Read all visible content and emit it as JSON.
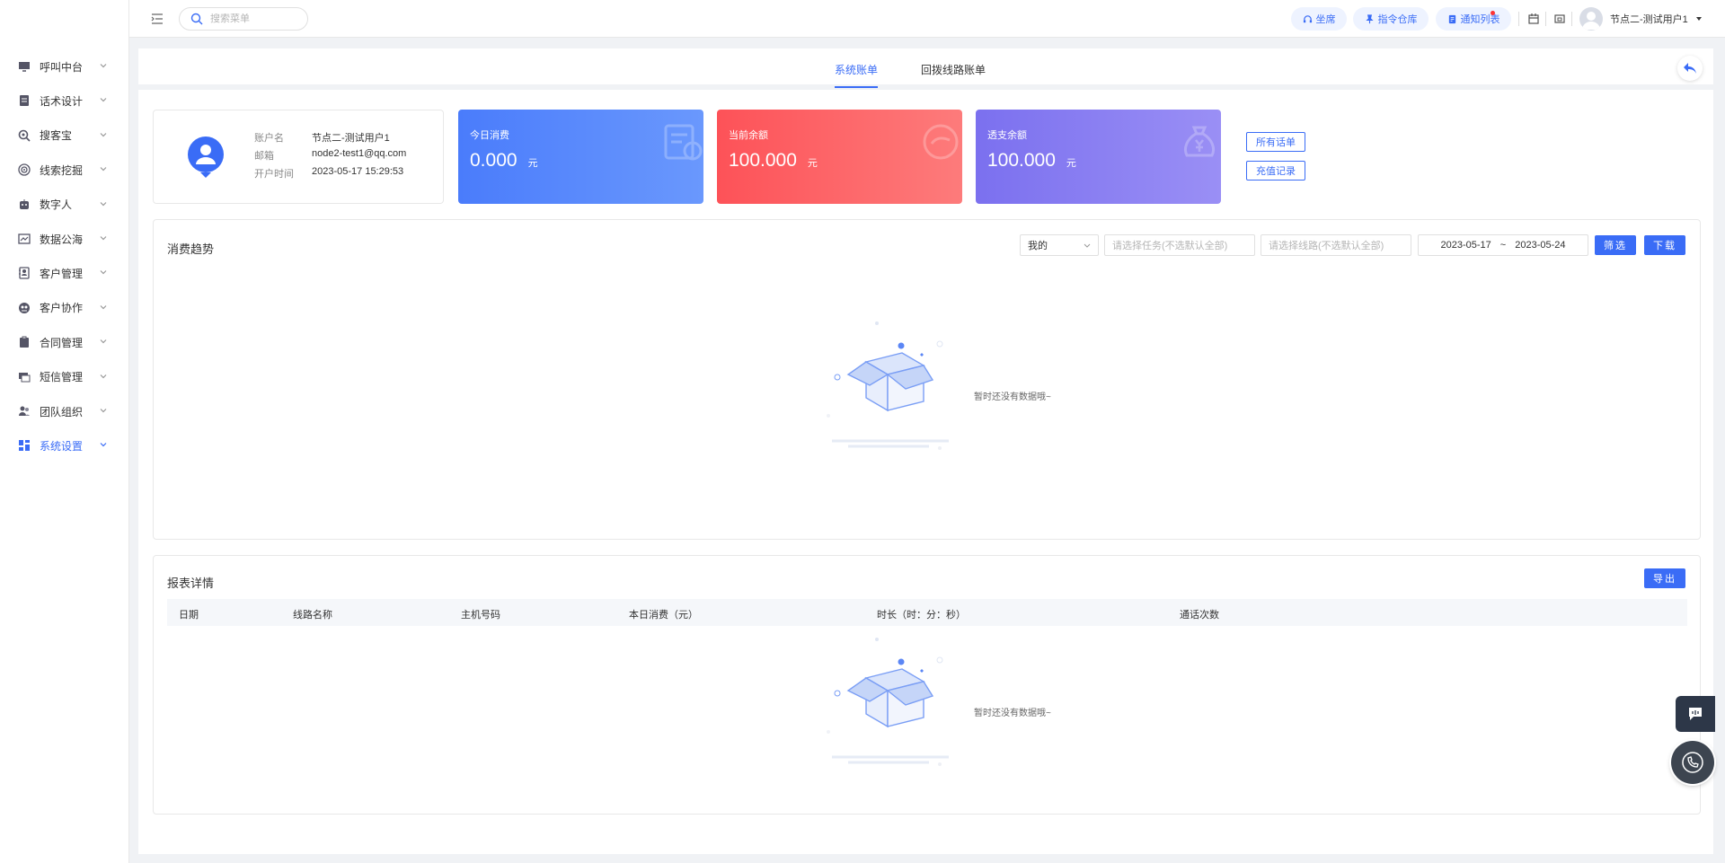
{
  "sidebar": {
    "items": [
      {
        "label": "呼叫中台",
        "icon": "monitor-icon"
      },
      {
        "label": "话术设计",
        "icon": "script-icon"
      },
      {
        "label": "搜客宝",
        "icon": "search-customer-icon"
      },
      {
        "label": "线索挖掘",
        "icon": "target-icon"
      },
      {
        "label": "数字人",
        "icon": "robot-icon"
      },
      {
        "label": "数据公海",
        "icon": "chart-icon"
      },
      {
        "label": "客户管理",
        "icon": "contacts-icon"
      },
      {
        "label": "客户协作",
        "icon": "collaborate-icon"
      },
      {
        "label": "合同管理",
        "icon": "clipboard-icon"
      },
      {
        "label": "短信管理",
        "icon": "message-icon"
      },
      {
        "label": "团队组织",
        "icon": "team-icon"
      },
      {
        "label": "系统设置",
        "icon": "grid-icon",
        "active": true
      }
    ]
  },
  "topbar": {
    "search_placeholder": "搜索菜单",
    "seat_label": "坐席",
    "command_label": "指令仓库",
    "notice_label": "通知列表",
    "user_name": "节点二-测试用户1"
  },
  "tabs": [
    "系统账单",
    "回拨线路账单"
  ],
  "account": {
    "name_label": "账户名",
    "name_value": "节点二-测试用户1",
    "email_label": "邮箱",
    "email_value": "node2-test1@qq.com",
    "open_label": "开户时间",
    "open_value": "2023-05-17 15:29:53"
  },
  "stats": [
    {
      "title": "今日消费",
      "value": "0.000",
      "unit": "元"
    },
    {
      "title": "当前余额",
      "value": "100.000",
      "unit": "元"
    },
    {
      "title": "透支余额",
      "value": "100.000",
      "unit": "元"
    }
  ],
  "buttons": {
    "all_bills": "所有话单",
    "recharge": "充值记录",
    "filter": "筛选",
    "download": "下载",
    "export": "导出"
  },
  "trend": {
    "title": "消费趋势",
    "scope_value": "我的",
    "task_placeholder": "请选择任务(不选默认全部)",
    "line_placeholder": "请选择线路(不选默认全部)",
    "date_start": "2023-05-17",
    "date_sep": "~",
    "date_end": "2023-05-24",
    "empty_text": "暂时还没有数据哦~"
  },
  "report": {
    "title": "报表详情",
    "columns": [
      "日期",
      "线路名称",
      "主机号码",
      "本日消费（元）",
      "时长（时：分：秒）",
      "通话次数"
    ],
    "empty_text": "暂时还没有数据哦~"
  },
  "colors": {
    "accent": "#3a6cf6",
    "card_blue": "#4a7cfb",
    "card_red": "#fd5258",
    "card_purple": "#7b70ef"
  }
}
